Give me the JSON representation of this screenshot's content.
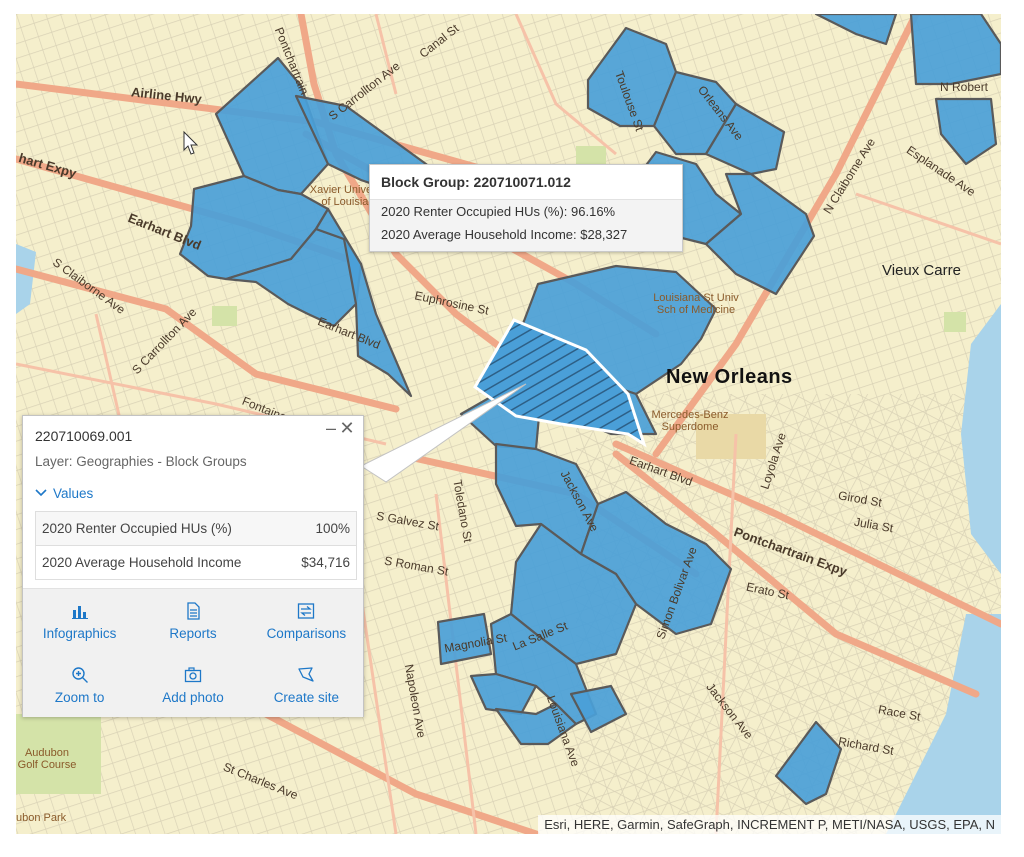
{
  "map": {
    "labels": {
      "airline_hwy": "Airline Hwy",
      "earhart_expy": "hart Expy",
      "earhart_blvd_w": "Earhart Blvd",
      "earhart_blvd_mid": "Earhart Blvd",
      "earhart_blvd_e": "Earhart Blvd",
      "canal_st": "Canal St",
      "s_carrollton_top": "S Carrollton Ave",
      "s_carrollton_bottom": "S Carrollton Ave",
      "s_claiborne_w": "S Claiborne Ave",
      "n_claiborne": "N Claiborne Ave",
      "esplanade": "Esplanade Ave",
      "orleans_ave": "Orleans Ave",
      "pontchartrain_expy": "Pontchartrain Expy",
      "pontchartrain_top": "Pontchartrain",
      "loyola_ave": "Loyola Ave",
      "jackson_ave_e": "Jackson Ave",
      "jackson_ave_w": "Jackson Ave",
      "st_charles": "St Charles Ave",
      "napoleon": "Napoleon Ave",
      "toledano": "Toledano St",
      "louisiana_ave": "Louisiana Ave",
      "la_salle": "La Salle St",
      "simon_bolivar": "Simon Bolivar Ave",
      "magnolia": "Magnolia St",
      "fontaine": "Fontaine",
      "euphrosine": "Euphrosine St",
      "girod": "Girod St",
      "julia": "Julia St",
      "erato": "Erato St",
      "race": "Race St",
      "richard": "Richard St",
      "n_roberts": "N Robert",
      "poydras_st": "S Galvez St",
      "s_roman": "S Roman St",
      "toulouse": "Toulouse St",
      "city": "New Orleans",
      "district": "Vieux Carre",
      "xavier": "Xavier University of Louisiana",
      "lsu": "Louisiana St Univ Sch of Medicine",
      "superdome": "Mercedes-Benz Superdome",
      "audubon_golf": "Audubon Golf Course",
      "audubon_park": "ubon Park"
    },
    "attribution": "Esri, HERE, Garmin, SafeGraph, INCREMENT P, METI/NASA, USGS, EPA, N"
  },
  "hover_tooltip": {
    "title": "Block Group: 220710071.012",
    "rows": [
      "2020 Renter Occupied HUs (%):  96.16%",
      "2020 Average Household Income:  $28,327"
    ]
  },
  "popup": {
    "title": "220710069.001",
    "minimize_glyph": "–",
    "close_glyph": "✕",
    "layer_text": "Layer: Geographies - Block Groups",
    "values_toggle": "Values",
    "values": [
      {
        "label": "2020 Renter Occupied HUs (%)",
        "value": "100%"
      },
      {
        "label": "2020 Average Household Income",
        "value": "$34,716"
      }
    ],
    "actions": [
      {
        "label": "Infographics",
        "icon": "bar-chart-icon"
      },
      {
        "label": "Reports",
        "icon": "document-icon"
      },
      {
        "label": "Comparisons",
        "icon": "compare-icon"
      },
      {
        "label": "Zoom to",
        "icon": "zoom-in-icon"
      },
      {
        "label": "Add photo",
        "icon": "camera-icon"
      },
      {
        "label": "Create site",
        "icon": "polygon-icon"
      }
    ]
  },
  "colors": {
    "map_base": "#f5efcc",
    "block_fill": "#4a9fd8",
    "block_stroke": "#5a5a5a",
    "major_road": "#f0a888",
    "minor_road": "#d6cfb4",
    "water": "#a9d3ea",
    "park": "#d4e3a8",
    "accent": "#1e78c8"
  }
}
